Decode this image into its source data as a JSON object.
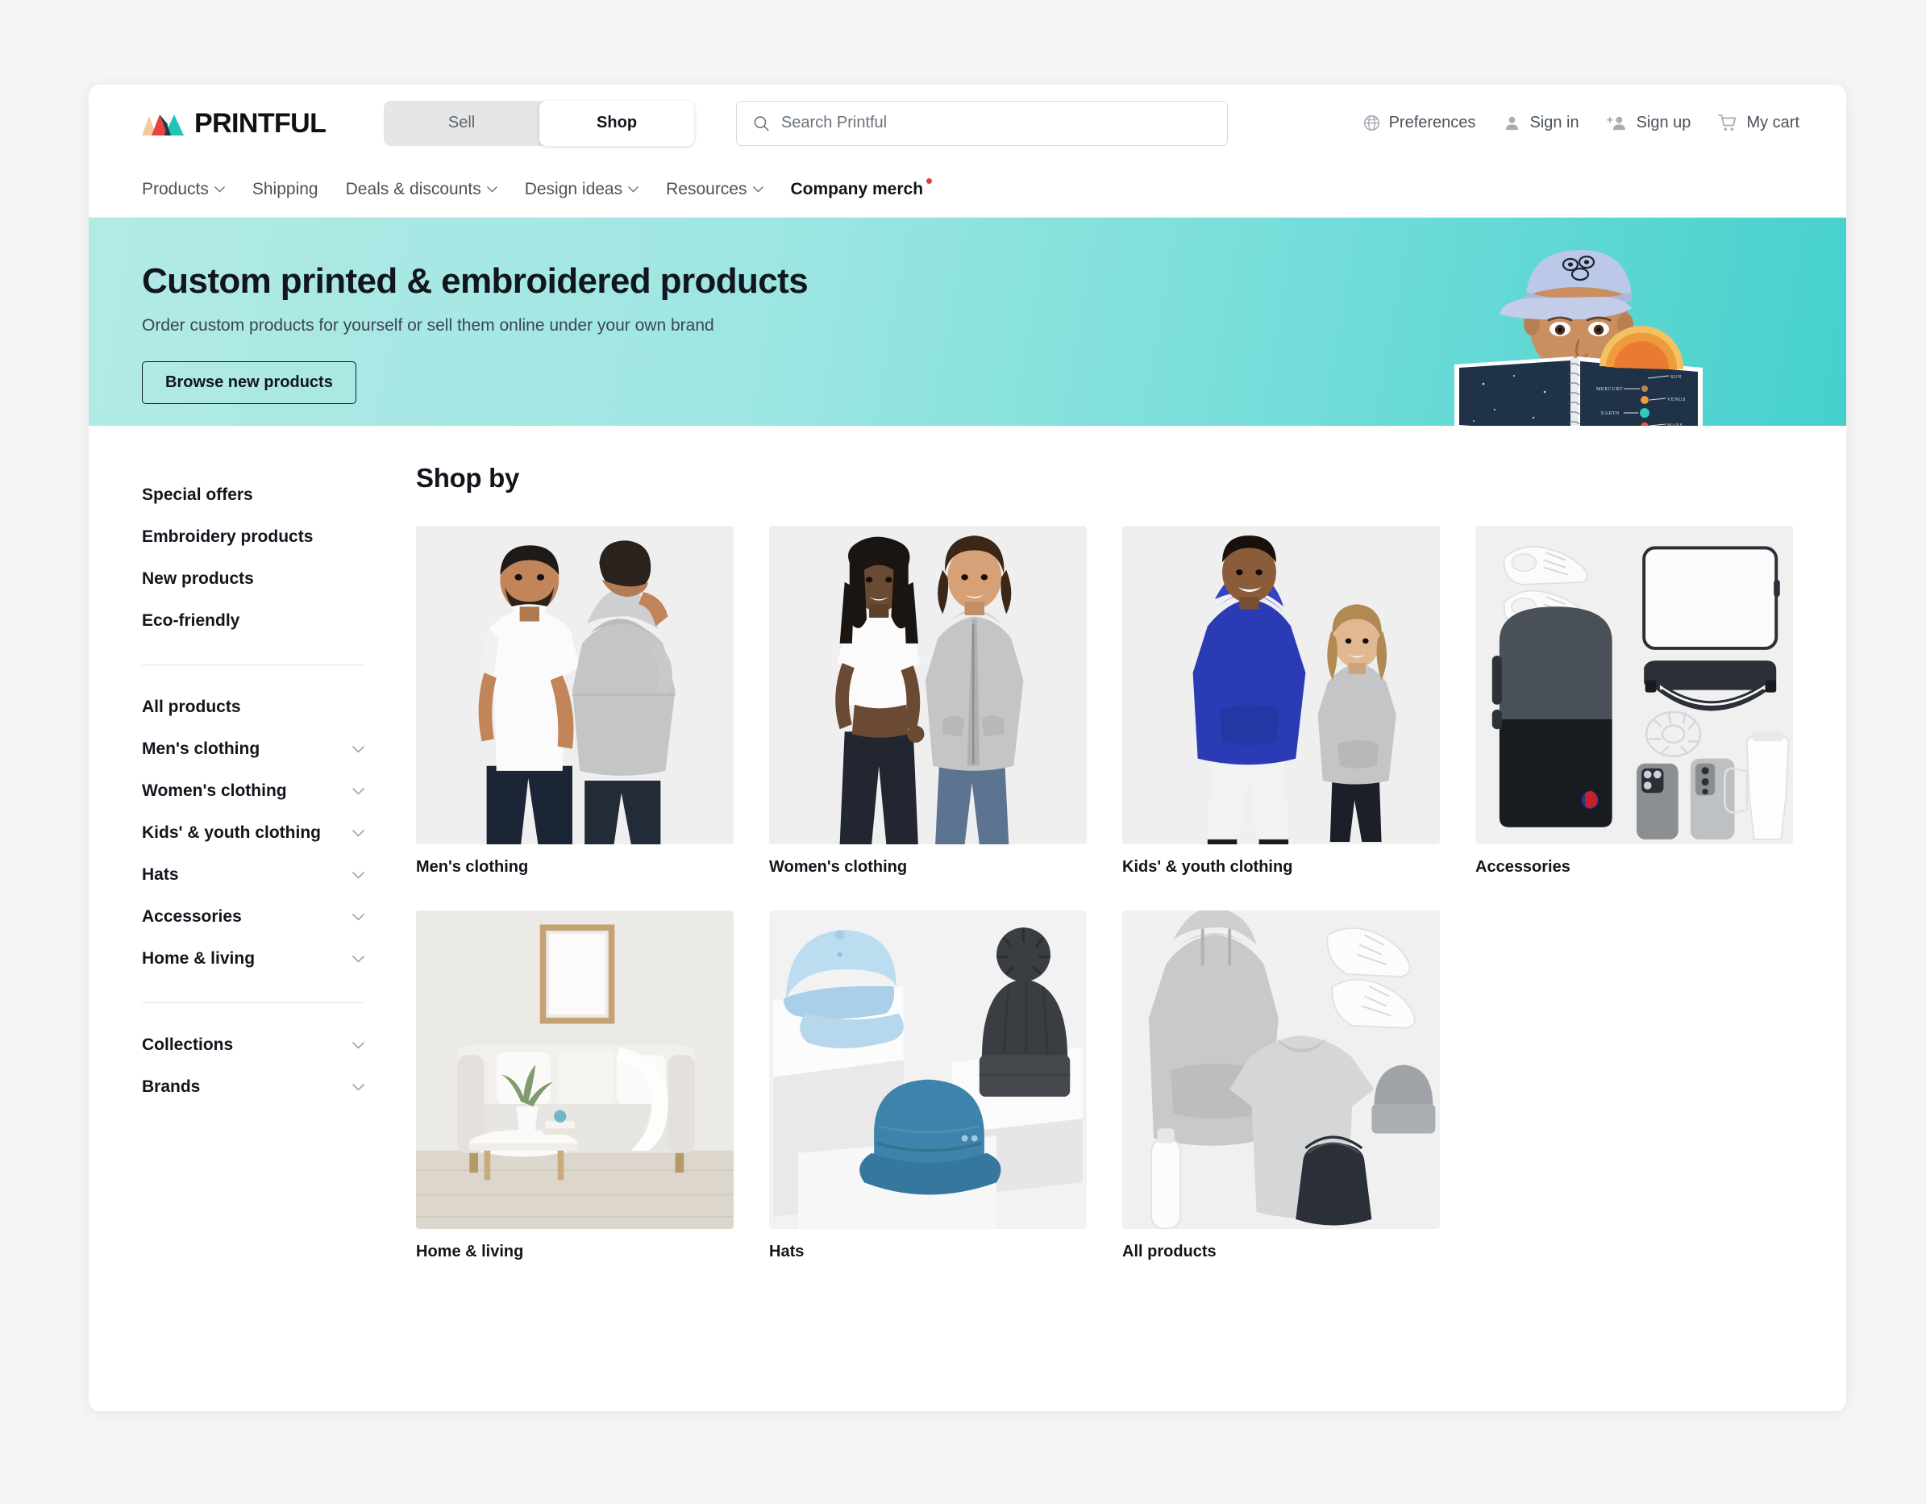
{
  "brand": {
    "logo_text": "PRINTFUL",
    "logo_colors": [
      "#f5c99b",
      "#e8443c",
      "#22c4b8",
      "#123f3c"
    ]
  },
  "topbar": {
    "toggle": [
      {
        "label": "Sell",
        "active": false
      },
      {
        "label": "Shop",
        "active": true
      }
    ],
    "search": {
      "placeholder": "Search Printful",
      "value": "",
      "icon": "search-icon"
    },
    "account": [
      {
        "label": "Preferences",
        "icon": "globe-icon"
      },
      {
        "label": "Sign in",
        "icon": "user-icon"
      },
      {
        "label": "Sign up",
        "icon": "user-plus-icon"
      },
      {
        "label": "My cart",
        "icon": "shopping-cart-icon"
      }
    ]
  },
  "nav": [
    {
      "label": "Products",
      "chevron": true,
      "bold": false,
      "dot": false
    },
    {
      "label": "Shipping",
      "chevron": false,
      "bold": false,
      "dot": false
    },
    {
      "label": "Deals & discounts",
      "chevron": true,
      "bold": false,
      "dot": false
    },
    {
      "label": "Design ideas",
      "chevron": true,
      "bold": false,
      "dot": false
    },
    {
      "label": "Resources",
      "chevron": true,
      "bold": false,
      "dot": false
    },
    {
      "label": "Company merch",
      "chevron": false,
      "bold": true,
      "dot": true
    }
  ],
  "hero": {
    "title": "Custom printed & embroidered products",
    "subtitle": "Order custom products for yourself or sell them online under your own brand",
    "button": "Browse new products",
    "gradient_from": "#b2eae6",
    "gradient_to": "#45d0cd",
    "artwork": "boy-reading-solar-system-notebook",
    "artwork_labels": [
      "SUN",
      "MERCURY",
      "VENUS",
      "EARTH",
      "MARS"
    ]
  },
  "sidebar": {
    "promo_links": [
      "Special offers",
      "Embroidery products",
      "New products",
      "Eco-friendly"
    ],
    "categories": [
      {
        "label": "All products",
        "chevron": false
      },
      {
        "label": "Men's clothing",
        "chevron": true
      },
      {
        "label": "Women's clothing",
        "chevron": true
      },
      {
        "label": "Kids' & youth clothing",
        "chevron": true
      },
      {
        "label": "Hats",
        "chevron": true
      },
      {
        "label": "Accessories",
        "chevron": true
      },
      {
        "label": "Home & living",
        "chevron": true
      }
    ],
    "extra": [
      {
        "label": "Collections",
        "chevron": true
      },
      {
        "label": "Brands",
        "chevron": true
      }
    ]
  },
  "main": {
    "title": "Shop by",
    "cards": [
      {
        "label": "Men's clothing",
        "art": "mens"
      },
      {
        "label": "Women's clothing",
        "art": "womens"
      },
      {
        "label": "Kids' & youth clothing",
        "art": "kids"
      },
      {
        "label": "Accessories",
        "art": "accessories"
      },
      {
        "label": "Home & living",
        "art": "home"
      },
      {
        "label": "Hats",
        "art": "hats"
      },
      {
        "label": "All products",
        "art": "all"
      }
    ]
  }
}
